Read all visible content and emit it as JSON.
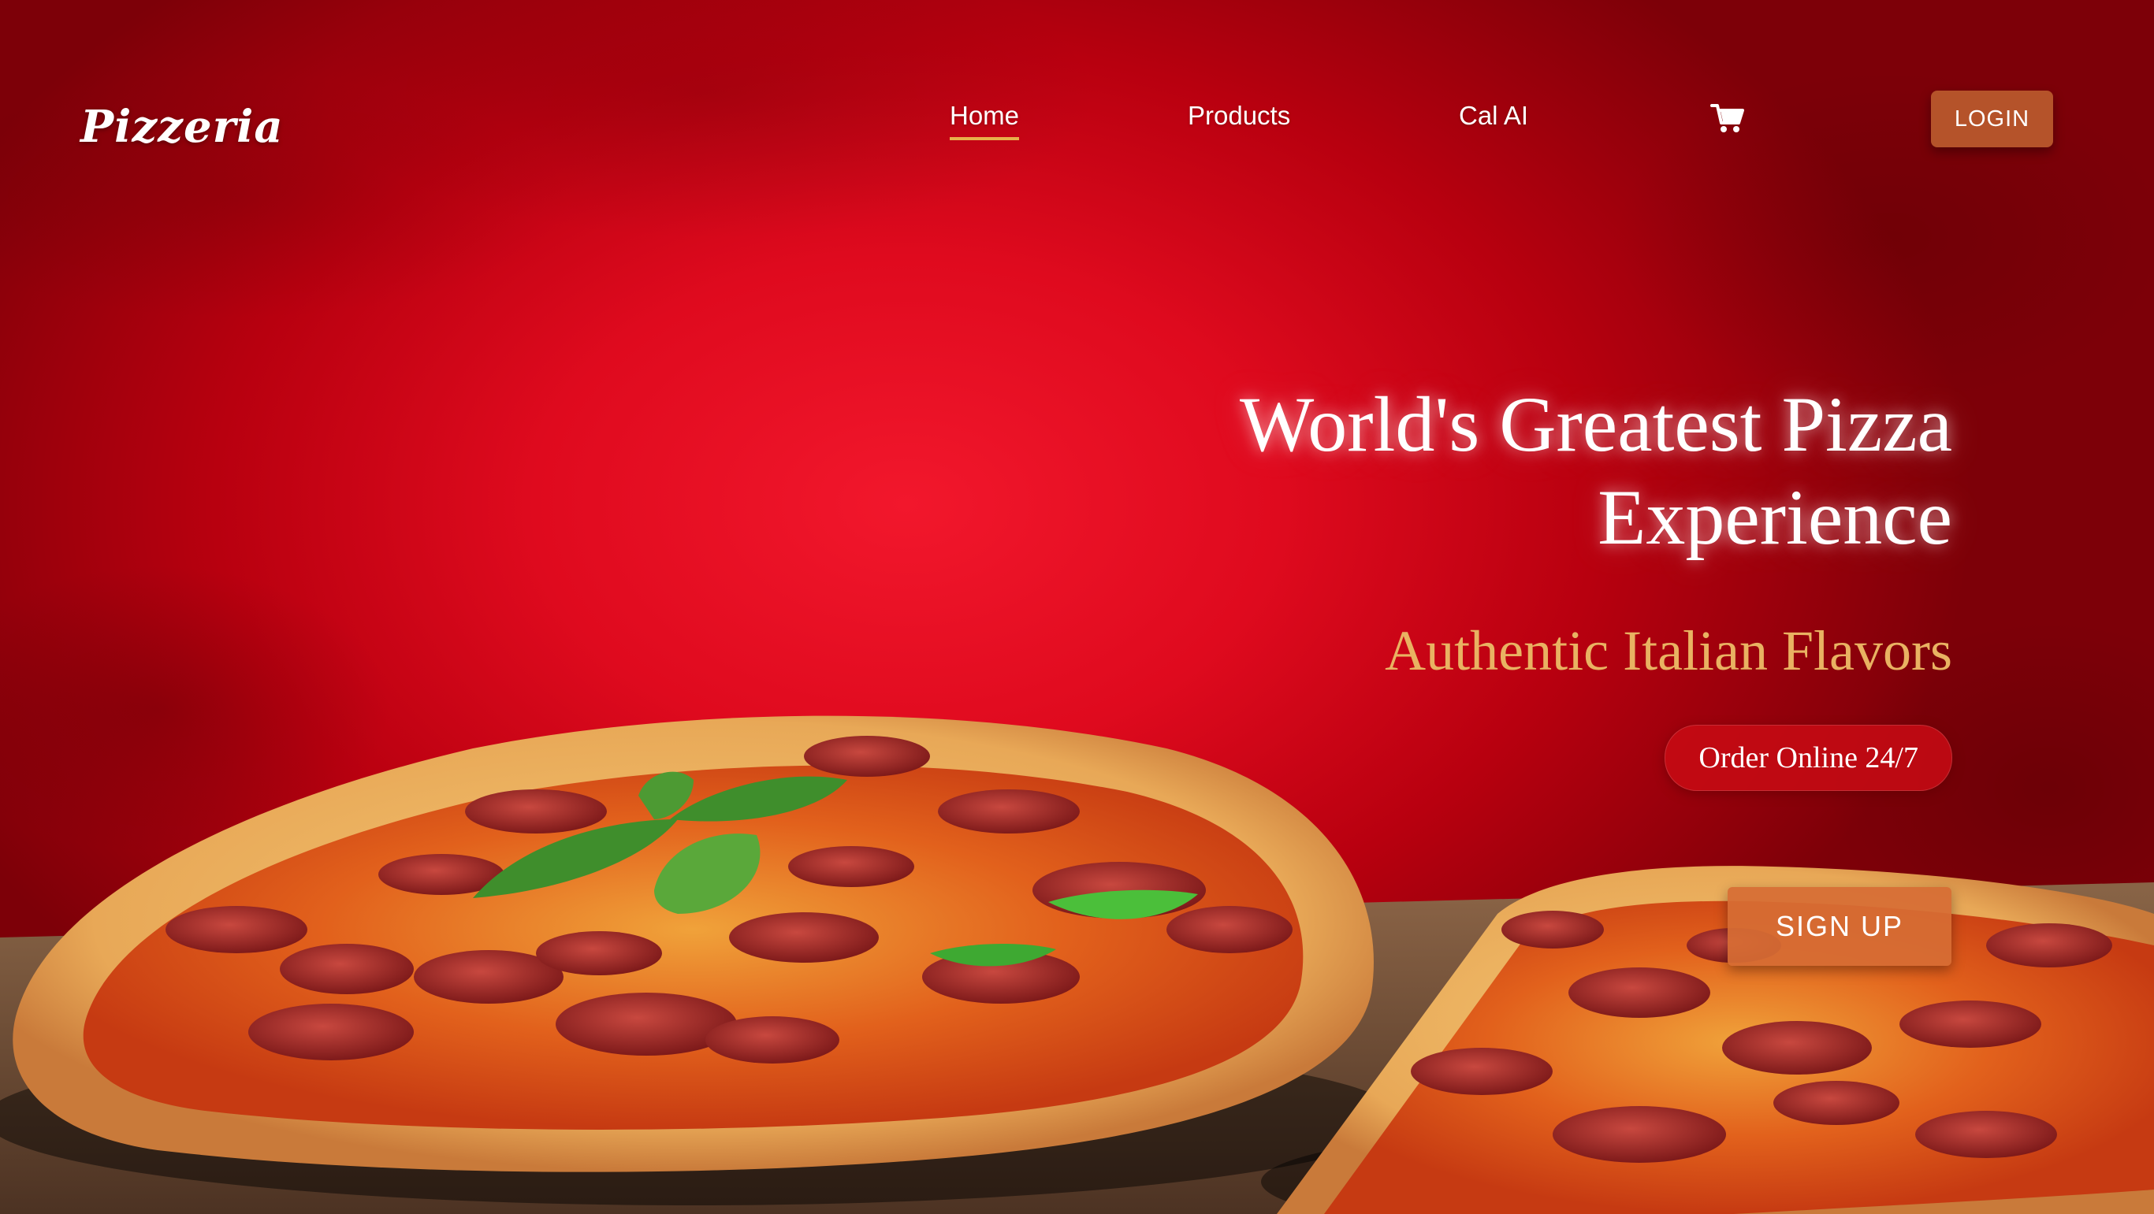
{
  "brand": {
    "logo_text": "Pizzeria"
  },
  "nav": {
    "items": [
      {
        "label": "Home",
        "active": true
      },
      {
        "label": "Products",
        "active": false
      },
      {
        "label": "Cal AI",
        "active": false
      }
    ],
    "cart_icon": "shopping-cart-icon",
    "login_label": "LOGIN"
  },
  "hero": {
    "title_line1": "World's Greatest Pizza",
    "title_line2": "Experience",
    "subtitle": "Authentic Italian Flavors",
    "order_label": "Order Online 24/7",
    "signup_label": "SIGN UP"
  },
  "colors": {
    "background_red": "#df0a1e",
    "accent_gold": "#e9b262",
    "button_orange": "#b5532a",
    "signup_orange": "#d66c34",
    "nav_underline": "#e8b04a"
  }
}
